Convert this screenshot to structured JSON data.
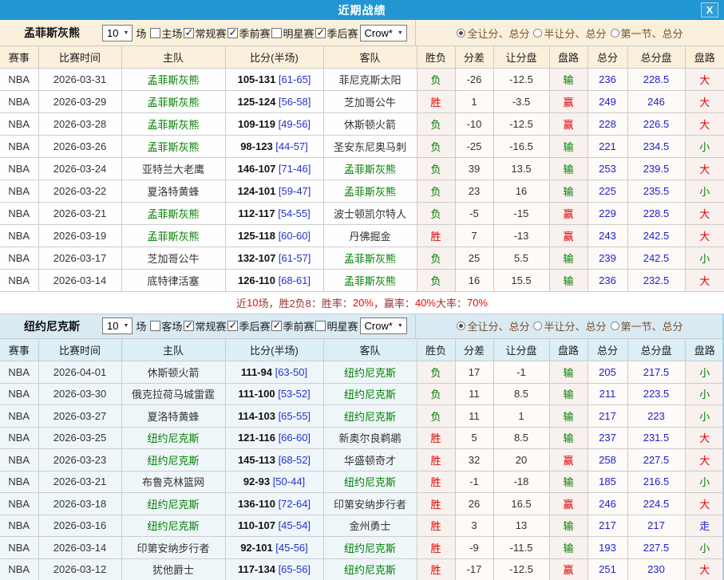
{
  "titlebar": {
    "title": "近期战绩",
    "close": "X"
  },
  "colors": {
    "focus_team": "#008000",
    "total_blue": "#2222cc",
    "outcome": {
      "胜": "#e10000",
      "负": "#008000",
      "赢": "#e10000",
      "输": "#008000",
      "大": "#e10000",
      "小": "#008000",
      "走": "#2222cc"
    }
  },
  "sections": [
    {
      "team": "孟菲斯灰熊",
      "games_count": "10",
      "games_unit": "场",
      "checkboxes": [
        {
          "label": "主场",
          "checked": false
        },
        {
          "label": "常规赛",
          "checked": true
        },
        {
          "label": "季前赛",
          "checked": true
        },
        {
          "label": "明星赛",
          "checked": false
        },
        {
          "label": "季后赛",
          "checked": true
        }
      ],
      "odds_provider": "Crow*",
      "radios": [
        {
          "label": "全让分、总分",
          "selected": true
        },
        {
          "label": "半让分、总分",
          "selected": false
        },
        {
          "label": "第一节、总分",
          "selected": false
        }
      ],
      "columns": [
        "赛事",
        "比赛时间",
        "主队",
        "比分(半场)",
        "客队",
        "胜负",
        "分差",
        "让分盘",
        "盘路",
        "总分",
        "总分盘",
        "盘路"
      ],
      "rows": [
        {
          "league": "NBA",
          "date": "2026-03-31",
          "home": "孟菲斯灰熊",
          "score": "105-131",
          "half": "[61-65]",
          "away": "菲尼克斯太阳",
          "result": "负",
          "diff": "-26",
          "handicap": "-12.5",
          "handicap_result": "输",
          "total": "236",
          "total_line": "228.5",
          "ou": "大"
        },
        {
          "league": "NBA",
          "date": "2026-03-29",
          "home": "孟菲斯灰熊",
          "score": "125-124",
          "half": "[56-58]",
          "away": "芝加哥公牛",
          "result": "胜",
          "diff": "1",
          "handicap": "-3.5",
          "handicap_result": "赢",
          "total": "249",
          "total_line": "246",
          "ou": "大"
        },
        {
          "league": "NBA",
          "date": "2026-03-28",
          "home": "孟菲斯灰熊",
          "score": "109-119",
          "half": "[49-56]",
          "away": "休斯顿火箭",
          "result": "负",
          "diff": "-10",
          "handicap": "-12.5",
          "handicap_result": "赢",
          "total": "228",
          "total_line": "226.5",
          "ou": "大"
        },
        {
          "league": "NBA",
          "date": "2026-03-26",
          "home": "孟菲斯灰熊",
          "score": "98-123",
          "half": "[44-57]",
          "away": "圣安东尼奥马刺",
          "result": "负",
          "diff": "-25",
          "handicap": "-16.5",
          "handicap_result": "输",
          "total": "221",
          "total_line": "234.5",
          "ou": "小"
        },
        {
          "league": "NBA",
          "date": "2026-03-24",
          "home": "亚特兰大老鹰",
          "score": "146-107",
          "half": "[71-46]",
          "away": "孟菲斯灰熊",
          "result": "负",
          "diff": "39",
          "handicap": "13.5",
          "handicap_result": "输",
          "total": "253",
          "total_line": "239.5",
          "ou": "大"
        },
        {
          "league": "NBA",
          "date": "2026-03-22",
          "home": "夏洛特黄蜂",
          "score": "124-101",
          "half": "[59-47]",
          "away": "孟菲斯灰熊",
          "result": "负",
          "diff": "23",
          "handicap": "16",
          "handicap_result": "输",
          "total": "225",
          "total_line": "235.5",
          "ou": "小"
        },
        {
          "league": "NBA",
          "date": "2026-03-21",
          "home": "孟菲斯灰熊",
          "score": "112-117",
          "half": "[54-55]",
          "away": "波士顿凯尔特人",
          "result": "负",
          "diff": "-5",
          "handicap": "-15",
          "handicap_result": "赢",
          "total": "229",
          "total_line": "228.5",
          "ou": "大"
        },
        {
          "league": "NBA",
          "date": "2026-03-19",
          "home": "孟菲斯灰熊",
          "score": "125-118",
          "half": "[60-60]",
          "away": "丹佛掘金",
          "result": "胜",
          "diff": "7",
          "handicap": "-13",
          "handicap_result": "赢",
          "total": "243",
          "total_line": "242.5",
          "ou": "大"
        },
        {
          "league": "NBA",
          "date": "2026-03-17",
          "home": "芝加哥公牛",
          "score": "132-107",
          "half": "[61-57]",
          "away": "孟菲斯灰熊",
          "result": "负",
          "diff": "25",
          "handicap": "5.5",
          "handicap_result": "输",
          "total": "239",
          "total_line": "242.5",
          "ou": "小"
        },
        {
          "league": "NBA",
          "date": "2026-03-14",
          "home": "底特律活塞",
          "score": "126-110",
          "half": "[68-61]",
          "away": "孟菲斯灰熊",
          "result": "负",
          "diff": "16",
          "handicap": "15.5",
          "handicap_result": "输",
          "total": "236",
          "total_line": "232.5",
          "ou": "大"
        }
      ]
    },
    {
      "team": "纽约尼克斯",
      "games_count": "10",
      "games_unit": "场",
      "checkboxes": [
        {
          "label": "客场",
          "checked": false
        },
        {
          "label": "常规赛",
          "checked": true
        },
        {
          "label": "季后赛",
          "checked": true
        },
        {
          "label": "季前赛",
          "checked": true
        },
        {
          "label": "明星赛",
          "checked": false
        }
      ],
      "odds_provider": "Crow*",
      "radios": [
        {
          "label": "全让分、总分",
          "selected": true
        },
        {
          "label": "半让分、总分",
          "selected": false
        },
        {
          "label": "第一节、总分",
          "selected": false
        }
      ],
      "columns": [
        "赛事",
        "比赛时间",
        "主队",
        "比分(半场)",
        "客队",
        "胜负",
        "分差",
        "让分盘",
        "盘路",
        "总分",
        "总分盘",
        "盘路"
      ],
      "rows": [
        {
          "league": "NBA",
          "date": "2026-04-01",
          "home": "休斯顿火箭",
          "score": "111-94",
          "half": "[63-50]",
          "away": "纽约尼克斯",
          "result": "负",
          "diff": "17",
          "handicap": "-1",
          "handicap_result": "输",
          "total": "205",
          "total_line": "217.5",
          "ou": "小"
        },
        {
          "league": "NBA",
          "date": "2026-03-30",
          "home": "俄克拉荷马城雷霆",
          "score": "111-100",
          "half": "[53-52]",
          "away": "纽约尼克斯",
          "result": "负",
          "diff": "11",
          "handicap": "8.5",
          "handicap_result": "输",
          "total": "211",
          "total_line": "223.5",
          "ou": "小"
        },
        {
          "league": "NBA",
          "date": "2026-03-27",
          "home": "夏洛特黄蜂",
          "score": "114-103",
          "half": "[65-55]",
          "away": "纽约尼克斯",
          "result": "负",
          "diff": "11",
          "handicap": "1",
          "handicap_result": "输",
          "total": "217",
          "total_line": "223",
          "ou": "小"
        },
        {
          "league": "NBA",
          "date": "2026-03-25",
          "home": "纽约尼克斯",
          "score": "121-116",
          "half": "[66-60]",
          "away": "新奥尔良鹈鹕",
          "result": "胜",
          "diff": "5",
          "handicap": "8.5",
          "handicap_result": "输",
          "total": "237",
          "total_line": "231.5",
          "ou": "大"
        },
        {
          "league": "NBA",
          "date": "2026-03-23",
          "home": "纽约尼克斯",
          "score": "145-113",
          "half": "[68-52]",
          "away": "华盛顿奇才",
          "result": "胜",
          "diff": "32",
          "handicap": "20",
          "handicap_result": "赢",
          "total": "258",
          "total_line": "227.5",
          "ou": "大"
        },
        {
          "league": "NBA",
          "date": "2026-03-21",
          "home": "布鲁克林篮网",
          "score": "92-93",
          "half": "[50-44]",
          "away": "纽约尼克斯",
          "result": "胜",
          "diff": "-1",
          "handicap": "-18",
          "handicap_result": "输",
          "total": "185",
          "total_line": "216.5",
          "ou": "小"
        },
        {
          "league": "NBA",
          "date": "2026-03-18",
          "home": "纽约尼克斯",
          "score": "136-110",
          "half": "[72-64]",
          "away": "印第安纳步行者",
          "result": "胜",
          "diff": "26",
          "handicap": "16.5",
          "handicap_result": "赢",
          "total": "246",
          "total_line": "224.5",
          "ou": "大"
        },
        {
          "league": "NBA",
          "date": "2026-03-16",
          "home": "纽约尼克斯",
          "score": "110-107",
          "half": "[45-54]",
          "away": "金州勇士",
          "result": "胜",
          "diff": "3",
          "handicap": "13",
          "handicap_result": "输",
          "total": "217",
          "total_line": "217",
          "ou": "走"
        },
        {
          "league": "NBA",
          "date": "2026-03-14",
          "home": "印第安纳步行者",
          "score": "92-101",
          "half": "[45-56]",
          "away": "纽约尼克斯",
          "result": "胜",
          "diff": "-9",
          "handicap": "-11.5",
          "handicap_result": "输",
          "total": "193",
          "total_line": "227.5",
          "ou": "小"
        },
        {
          "league": "NBA",
          "date": "2026-03-12",
          "home": "犹他爵士",
          "score": "117-134",
          "half": "[65-56]",
          "away": "纽约尼克斯",
          "result": "胜",
          "diff": "-17",
          "handicap": "-12.5",
          "handicap_result": "赢",
          "total": "251",
          "total_line": "230",
          "ou": "大"
        }
      ]
    }
  ],
  "summary": {
    "segments": [
      {
        "text": "近 ",
        "red": false
      },
      {
        "text": "10",
        "red": true
      },
      {
        "text": " 场，胜2负8：胜率：",
        "red": false
      },
      {
        "text": "20%",
        "red": true
      },
      {
        "text": "，赢率：",
        "red": false
      },
      {
        "text": "40%",
        "red": true
      },
      {
        "text": " 大率：",
        "red": false
      },
      {
        "text": "70%",
        "red": true
      }
    ]
  }
}
